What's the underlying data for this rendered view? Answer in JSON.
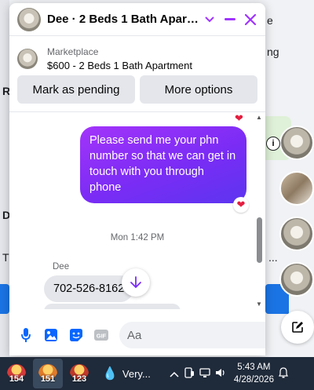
{
  "background": {
    "frag_r": "R",
    "frag_ng": "ng",
    "frag_d": "D",
    "frag_t": "T",
    "frag_ellipsis": "..."
  },
  "chat": {
    "header_title": "Dee · 2 Beds 1 Bath Apart...",
    "marketplace_label": "Marketplace",
    "listing_title": "$600 - 2 Beds 1 Bath Apartment",
    "mark_pending_label": "Mark as pending",
    "more_options_label": "More options",
    "outgoing_message": "Please send me your phn number so that we can get in touch with you through phone",
    "timestamp": "Mon 1:42 PM",
    "sender_name": "Dee",
    "incoming_message": "702-526-8162",
    "input_placeholder": "Aa",
    "reaction": "❤"
  },
  "icons": {
    "minimize": "minimize-icon",
    "close": "close-icon",
    "chevron": "chevron-down-icon",
    "mic": "microphone-icon",
    "image": "image-icon",
    "sticker": "sticker-icon",
    "gif": "gif-icon",
    "emoji": "emoji-icon",
    "like": "thumbs-up-icon",
    "compose": "new-message-icon"
  },
  "taskbar": {
    "app1_badge": "154",
    "app2_badge": "151",
    "app3_badge": "123",
    "weather_text": "Very...",
    "time": "5:43 AM",
    "date": "4/28/2026"
  },
  "colors": {
    "accent": "#a033ff",
    "bubble_out_start": "#a334fa",
    "bubble_out_end": "#5d35f0",
    "bubble_in": "#e4e6eb",
    "like_blue": "#0866ff"
  }
}
